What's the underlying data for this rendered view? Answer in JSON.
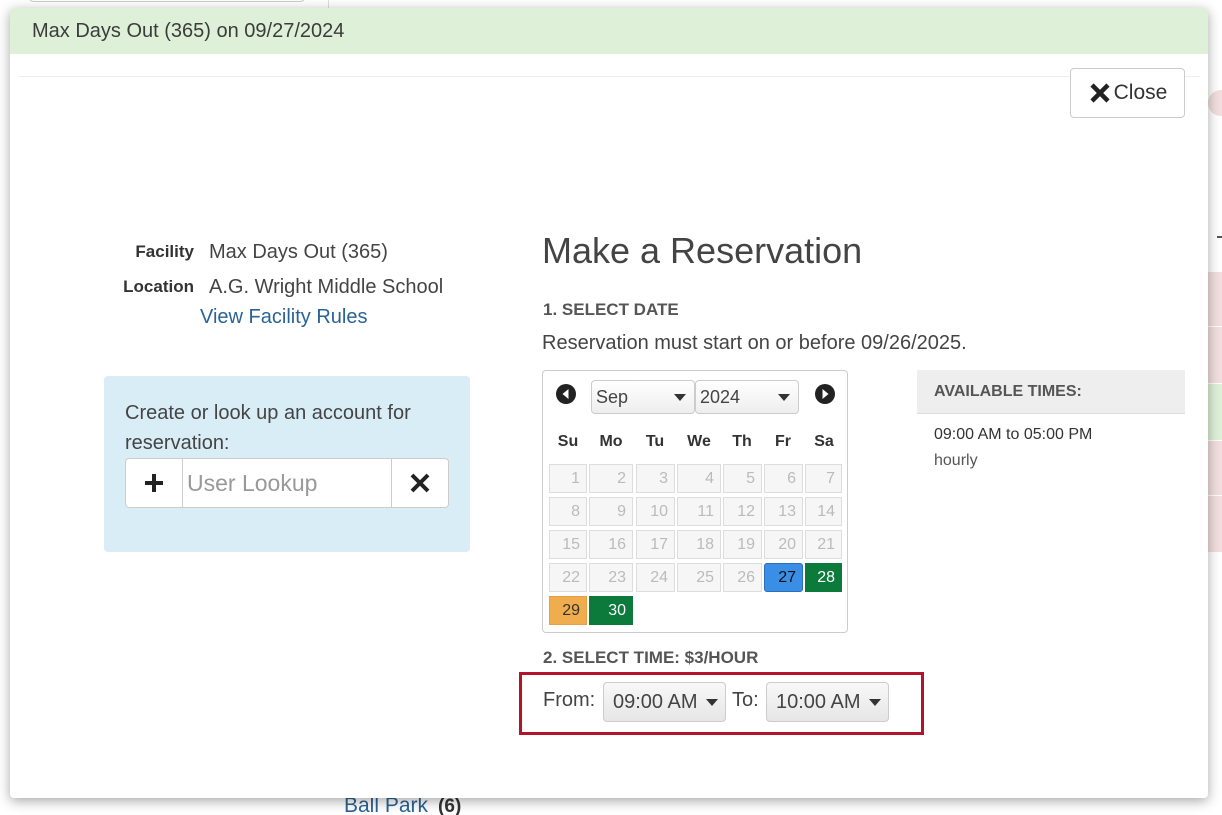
{
  "background": {
    "link_label": "Ball Park",
    "link_count": "6"
  },
  "alert": {
    "text": "Max Days Out (365) on 09/27/2024"
  },
  "close_label": "Close",
  "facility": {
    "facility_label": "Facility",
    "facility_value": "Max Days Out (365)",
    "location_label": "Location",
    "location_value": "A.G. Wright Middle School",
    "rules_link": "View Facility Rules"
  },
  "lookup": {
    "text": "Create or look up an account for reservation:",
    "placeholder": "User Lookup"
  },
  "reservation": {
    "title": "Make a Reservation",
    "step1": "1. SELECT DATE",
    "note": "Reservation must start on or before 09/26/2025.",
    "step2": "2. SELECT TIME: $3/HOUR"
  },
  "calendar": {
    "month": "Sep",
    "year": "2024",
    "weekdays": [
      "Su",
      "Mo",
      "Tu",
      "We",
      "Th",
      "Fr",
      "Sa"
    ],
    "days": [
      {
        "d": "1",
        "state": "disabled"
      },
      {
        "d": "2",
        "state": "disabled"
      },
      {
        "d": "3",
        "state": "disabled"
      },
      {
        "d": "4",
        "state": "disabled"
      },
      {
        "d": "5",
        "state": "disabled"
      },
      {
        "d": "6",
        "state": "disabled"
      },
      {
        "d": "7",
        "state": "disabled"
      },
      {
        "d": "8",
        "state": "disabled"
      },
      {
        "d": "9",
        "state": "disabled"
      },
      {
        "d": "10",
        "state": "disabled"
      },
      {
        "d": "11",
        "state": "disabled"
      },
      {
        "d": "12",
        "state": "disabled"
      },
      {
        "d": "13",
        "state": "disabled"
      },
      {
        "d": "14",
        "state": "disabled"
      },
      {
        "d": "15",
        "state": "disabled"
      },
      {
        "d": "16",
        "state": "disabled"
      },
      {
        "d": "17",
        "state": "disabled"
      },
      {
        "d": "18",
        "state": "disabled"
      },
      {
        "d": "19",
        "state": "disabled"
      },
      {
        "d": "20",
        "state": "disabled"
      },
      {
        "d": "21",
        "state": "disabled"
      },
      {
        "d": "22",
        "state": "disabled"
      },
      {
        "d": "23",
        "state": "disabled"
      },
      {
        "d": "24",
        "state": "disabled"
      },
      {
        "d": "25",
        "state": "disabled"
      },
      {
        "d": "26",
        "state": "disabled"
      },
      {
        "d": "27",
        "state": "selected"
      },
      {
        "d": "28",
        "state": "available"
      },
      {
        "d": "29",
        "state": "partial"
      },
      {
        "d": "30",
        "state": "available"
      }
    ],
    "colors": {
      "selected": "#3a8ee6",
      "available": "#0b7a3b",
      "partial": "#f0ad4e"
    }
  },
  "available": {
    "heading": "AVAILABLE TIMES:",
    "time": "09:00 AM to 05:00 PM",
    "rate": "hourly"
  },
  "time": {
    "from_label": "From:",
    "from_value": "09:00 AM",
    "to_label": "To:",
    "to_value": "10:00 AM",
    "highlight_color": "#b5122b"
  }
}
